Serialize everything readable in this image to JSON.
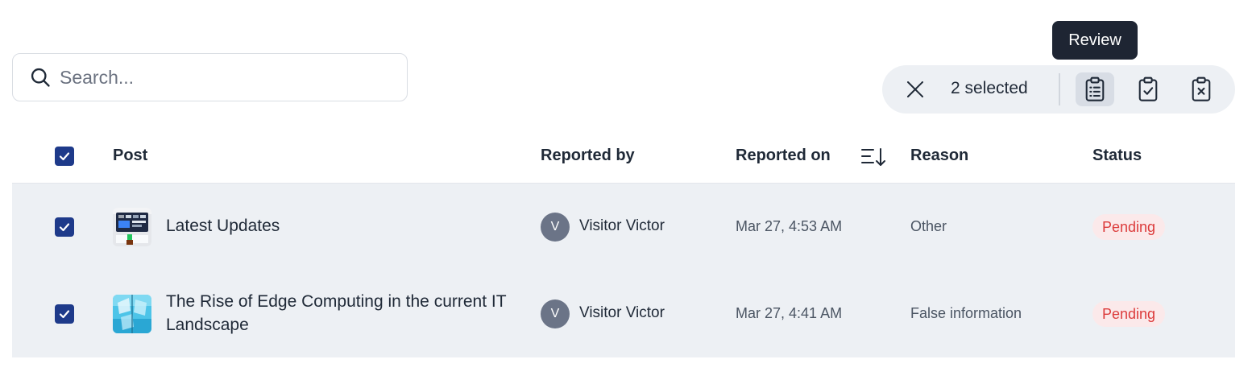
{
  "search": {
    "placeholder": "Search...",
    "value": ""
  },
  "tooltip": {
    "text": "Review"
  },
  "bulk_actions": {
    "selected_label": "2 selected",
    "icons": [
      "close-icon",
      "clipboard-list-icon",
      "clipboard-check-icon",
      "clipboard-x-icon"
    ]
  },
  "table": {
    "columns": {
      "post": "Post",
      "reported_by": "Reported by",
      "reported_on": "Reported on",
      "reason": "Reason",
      "status": "Status"
    },
    "rows": [
      {
        "title": "Latest Updates",
        "avatar_initial": "V",
        "reporter": "Visitor Victor",
        "reported_on": "Mar 27, 4:53 AM",
        "reason": "Other",
        "status": "Pending",
        "checked": true
      },
      {
        "title": "The Rise of Edge Computing in the current IT Landscape",
        "avatar_initial": "V",
        "reporter": "Visitor Victor",
        "reported_on": "Mar 27, 4:41 AM",
        "reason": "False information",
        "status": "Pending",
        "checked": true
      }
    ]
  },
  "colors": {
    "checkbox": "#1e3a8a",
    "row_selected_bg": "#edf0f4",
    "pending_text": "#dc3b3b",
    "pending_bg": "#fbe9ea",
    "tooltip_bg": "#1e2533"
  }
}
